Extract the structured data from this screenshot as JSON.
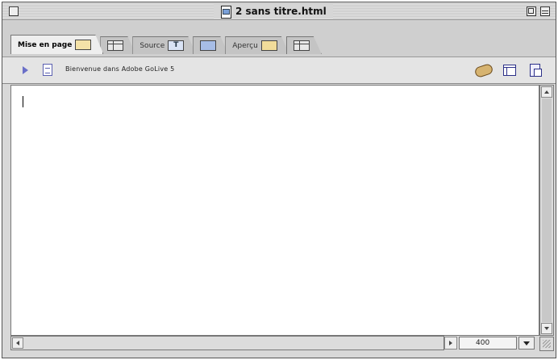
{
  "window": {
    "title": "2 sans titre.html"
  },
  "tabs": [
    {
      "label": "Mise en page",
      "icon": "layout-icon",
      "active": true
    },
    {
      "label": "",
      "icon": "split-layout-icon",
      "active": false
    },
    {
      "label": "Source",
      "icon": "source-icon",
      "badge": "T",
      "active": false
    },
    {
      "label": "",
      "icon": "split-source-icon",
      "active": false
    },
    {
      "label": "Aperçu",
      "icon": "preview-icon",
      "active": false
    },
    {
      "label": "",
      "icon": "split-preview-icon",
      "active": false
    }
  ],
  "toolbar": {
    "page_label": "Bienvenue dans Adobe GoLive 5",
    "icons": [
      "disclosure-triangle-icon",
      "page-properties-icon",
      "link-icon",
      "frame-view-icon",
      "document-tools-icon"
    ]
  },
  "status": {
    "width_value": "400"
  },
  "colors": {
    "window_bg": "#d8d8d8",
    "content_bg": "#ffffff",
    "accent_purple": "#6a6fc8"
  }
}
